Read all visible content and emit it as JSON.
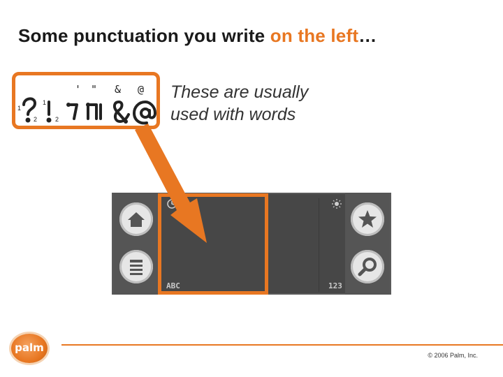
{
  "title": {
    "prefix": "Some punctuation you write ",
    "accent": "on the left",
    "suffix": "…"
  },
  "strokes": {
    "labels": [
      "'",
      "\"",
      "&",
      "@"
    ],
    "step_numbers": [
      "1",
      "2",
      "1",
      "2"
    ]
  },
  "side_text": {
    "line1": "These are usually",
    "line2": "used with words"
  },
  "device": {
    "left_label": "ABC",
    "right_label": "123",
    "buttons": [
      "home-icon",
      "menu-icon",
      "star-icon",
      "search-icon"
    ]
  },
  "footer": {
    "logo": "palm",
    "copyright": "© 2006 Palm, Inc."
  },
  "colors": {
    "accent": "#e87722",
    "text": "#1a1a1a",
    "device": "#5a5a5a"
  }
}
